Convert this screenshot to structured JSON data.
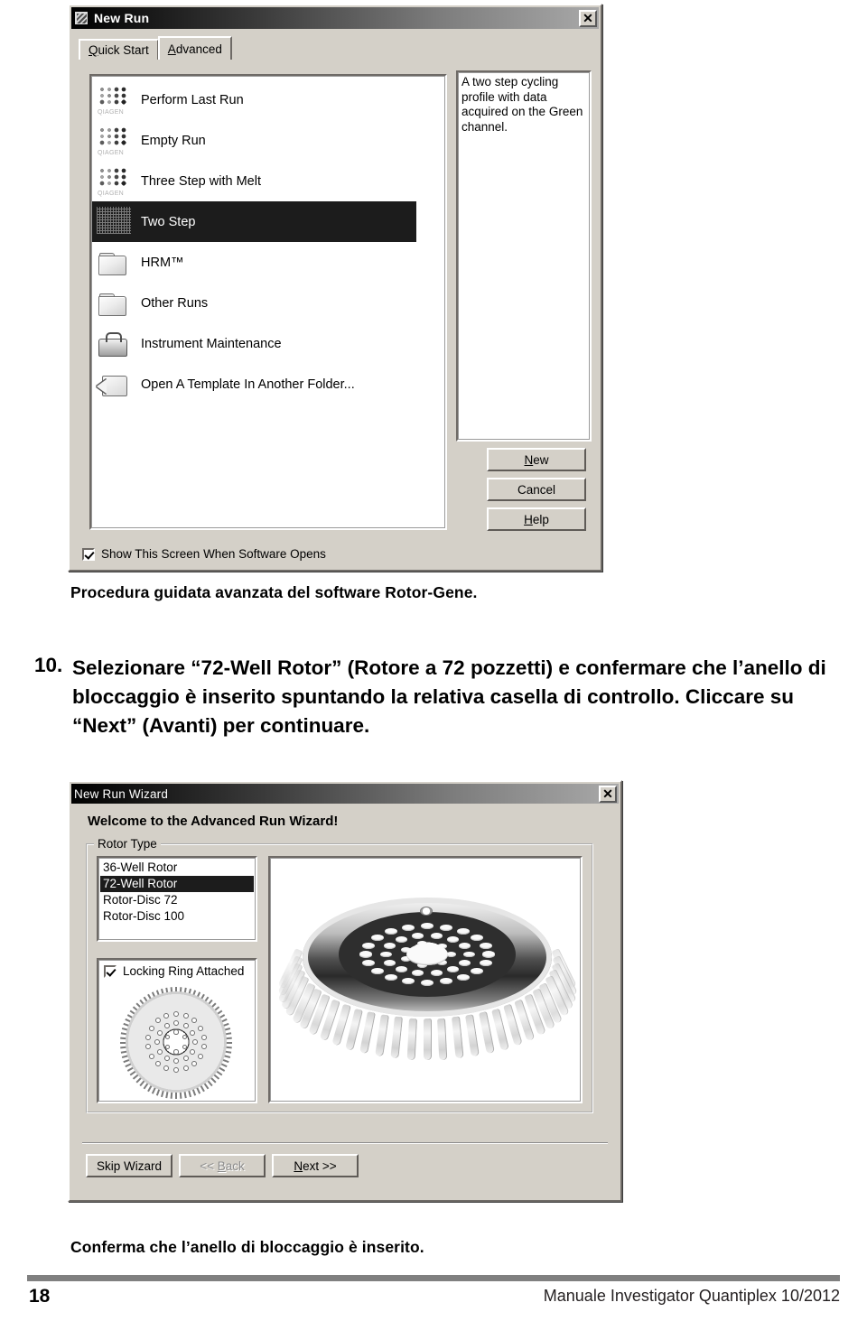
{
  "document": {
    "caption_top": "Procedura guidata avanzata del software Rotor-Gene.",
    "step_number": "10.",
    "step_text": "Selezionare “72-Well Rotor” (Rotore a 72 pozzetti) e confermare che l’anello di bloccaggio è inserito spuntando la relativa casella di controllo. Cliccare su “Next” (Avanti) per continuare.",
    "caption_bottom": "Conferma che l’anello di bloccaggio è inserito.",
    "page_number": "18",
    "footer": "Manuale Investigator Quantiplex   10/2012"
  },
  "new_run_dialog": {
    "title": "New Run",
    "close_label": "✕",
    "tabs": [
      {
        "label": "Quick Start",
        "accel": "Q",
        "rest": "uick Start",
        "active": false
      },
      {
        "label": "Advanced",
        "accel": "A",
        "rest": "dvanced",
        "active": true
      }
    ],
    "templates": [
      {
        "label": "Perform Last Run",
        "icon": "qiagen-plate-icon",
        "selected": false
      },
      {
        "label": "Empty Run",
        "icon": "qiagen-plate-icon",
        "selected": false
      },
      {
        "label": "Three Step with Melt",
        "icon": "qiagen-plate-icon",
        "selected": false
      },
      {
        "label": "Two Step",
        "icon": "qiagen-plate-icon",
        "selected": true
      },
      {
        "label": "HRM™",
        "icon": "folder-icon",
        "selected": false
      },
      {
        "label": "Other Runs",
        "icon": "folder-icon",
        "selected": false
      },
      {
        "label": "Instrument Maintenance",
        "icon": "toolbox-icon",
        "selected": false
      },
      {
        "label": "Open A Template In Another Folder...",
        "icon": "open-folder-icon",
        "selected": false
      }
    ],
    "description": "A two step cycling profile with data acquired on the Green channel.",
    "buttons": [
      {
        "label": "New",
        "accel": "N",
        "rest": "ew"
      },
      {
        "label": "Cancel",
        "accel": "",
        "rest": "Cancel"
      },
      {
        "label": "Help",
        "accel": "H",
        "rest": "elp"
      }
    ],
    "show_on_open": {
      "label": "Show This Screen When Software Opens",
      "accel": "S",
      "rest": "how This Screen When Software Opens",
      "checked": true
    }
  },
  "wizard_dialog": {
    "title": "New Run Wizard",
    "close_label": "✕",
    "heading": "Welcome to the Advanced Run Wizard!",
    "group_label": "Rotor Type",
    "rotor_types": [
      {
        "label": "36-Well Rotor",
        "selected": false
      },
      {
        "label": "72-Well Rotor",
        "selected": true
      },
      {
        "label": "Rotor-Disc 72",
        "selected": false
      },
      {
        "label": "Rotor-Disc 100",
        "selected": false
      }
    ],
    "locking_ring": {
      "label": "Locking Ring Attached",
      "accel": "R",
      "before": "Locking ",
      "rest": "ing Attached",
      "checked": true
    },
    "nav_buttons": [
      {
        "label": "Skip Wizard",
        "accel": "",
        "rest": "Skip Wizard",
        "disabled": false
      },
      {
        "label": "<< Back",
        "accel": "B",
        "before": "<< ",
        "rest": "ack",
        "disabled": true
      },
      {
        "label": "Next >>",
        "accel": "N",
        "before": "",
        "rest": "ext >>",
        "disabled": false
      }
    ],
    "rotor_image_alt": "72-well rotor with locking ring and tubes",
    "locking_ring_image_alt": "top view of rotor with locking ring"
  },
  "colors": {
    "dialog_face": "#d4d0c8",
    "selection": "#1c1c1c",
    "rule": "#808080"
  }
}
